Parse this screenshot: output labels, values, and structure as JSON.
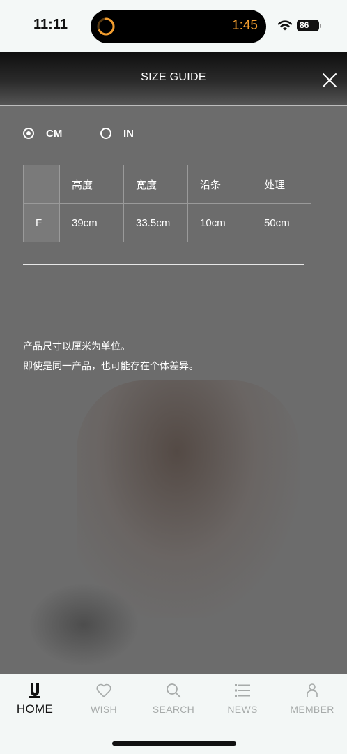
{
  "status_bar": {
    "time": "11:11",
    "timer": "1:45",
    "battery": "86"
  },
  "modal": {
    "title": "SIZE GUIDE",
    "units": [
      {
        "label": "CM",
        "selected": true
      },
      {
        "label": "IN",
        "selected": false
      }
    ],
    "table": {
      "headers": [
        "",
        "高度",
        "宽度",
        "沿条",
        "处理"
      ],
      "rows": [
        [
          "F",
          "39cm",
          "33.5cm",
          "10cm",
          "50cm"
        ]
      ]
    },
    "note_lines": [
      "产品尺寸以厘米为单位。",
      "即使是同一产品，也可能存在个体差异。"
    ]
  },
  "bottom_nav": {
    "items": [
      {
        "label": "HOME",
        "icon": "uniqlo-u-icon",
        "active": true
      },
      {
        "label": "WISH",
        "icon": "heart-icon",
        "active": false
      },
      {
        "label": "SEARCH",
        "icon": "search-icon",
        "active": false
      },
      {
        "label": "NEWS",
        "icon": "list-icon",
        "active": false
      },
      {
        "label": "MEMBER",
        "icon": "person-icon",
        "active": false
      }
    ]
  },
  "colors": {
    "timer_accent": "#f29d2f",
    "overlay": "#6c6c6c",
    "nav_inactive": "#a7abaa"
  }
}
